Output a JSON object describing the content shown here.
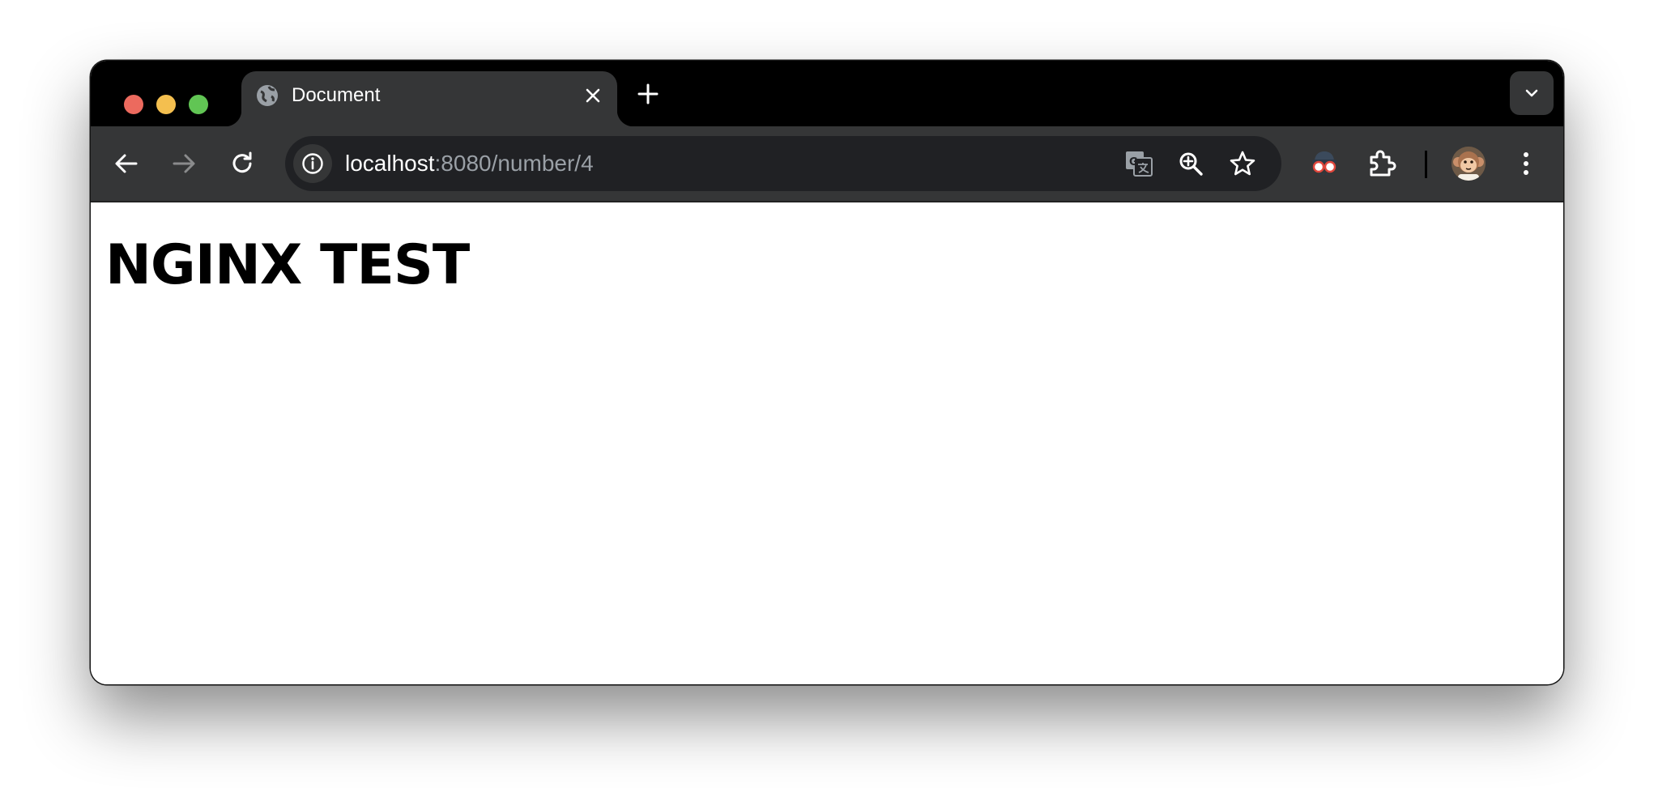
{
  "browser": {
    "tab": {
      "title": "Document",
      "favicon": "globe-icon"
    },
    "address_bar": {
      "host": "localhost",
      "path": ":8080/number/4"
    },
    "icons": {
      "back": "back-arrow-icon",
      "forward": "forward-arrow-icon",
      "reload": "reload-icon",
      "site_info": "info-icon",
      "translate": "translate-icon",
      "zoom": "zoom-in-icon",
      "bookmark": "star-icon",
      "extension_1": "spy-glasses-icon",
      "extensions": "puzzle-icon",
      "profile": "avatar",
      "menu": "kebab-menu-icon",
      "new_tab": "plus-icon",
      "tab_search": "chevron-down-icon",
      "close_tab": "close-icon"
    },
    "colors": {
      "titlebar": "#000000",
      "toolbar": "#353637",
      "omnibox": "#202124",
      "close": "#ec6a5e",
      "minimize": "#f4bf4f",
      "maximize": "#61c554"
    }
  },
  "page": {
    "heading": "NGINX TEST"
  }
}
